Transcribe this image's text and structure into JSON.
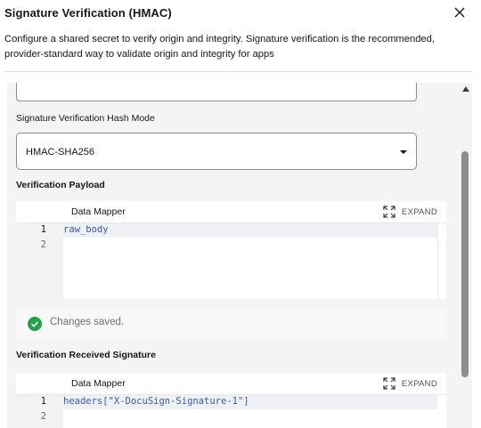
{
  "modal": {
    "title": "Signature Verification (HMAC)",
    "description": "Configure a shared secret to verify origin and integrity. Signature verification is the recommended, provider-standard way to validate origin and integrity for apps"
  },
  "fields": {
    "hash_mode": {
      "label": "Signature Verification Hash Mode",
      "value": "HMAC-SHA256"
    },
    "payload": {
      "label": "Verification Payload",
      "mapper_title": "Data Mapper",
      "expand_label": "EXPAND",
      "lines": [
        {
          "num": "1",
          "code": "raw_body"
        },
        {
          "num": "2",
          "code": ""
        }
      ]
    },
    "received_signature": {
      "label": "Verification Received Signature",
      "mapper_title": "Data Mapper",
      "expand_label": "EXPAND",
      "lines": [
        {
          "num": "1",
          "code": "headers[\"X-DocuSign-Signature-1\"]"
        },
        {
          "num": "2",
          "code": ""
        }
      ]
    }
  },
  "toast": {
    "message": "Changes saved.",
    "icon": "checkmark-filled-icon",
    "color": "#24a148"
  },
  "colors": {
    "accent_border": "#8a3ffc",
    "code_text": "#3a5aa8"
  }
}
